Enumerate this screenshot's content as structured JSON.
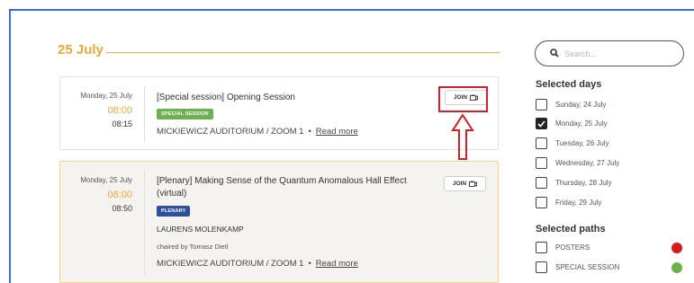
{
  "date_heading": "25 July",
  "sessions": [
    {
      "day": "Monday, 25 July",
      "start": "08:00",
      "end": "08:15",
      "title": "[Special session] Opening Session",
      "badge": "SPECIAL SESSION",
      "location": "MICKIEWICZ AUDITORIUM / ZOOM 1",
      "read_more": "Read more",
      "join_label": "JOIN"
    },
    {
      "day": "Monday, 25 July",
      "start": "08:00",
      "end": "08:50",
      "title": "[Plenary] Making Sense of the Quantum Anomalous Hall Effect (virtual)",
      "badge": "PLENARY",
      "speaker": "LAURENS MOLENKAMP",
      "chair": "chaired by Tomasz Dietl",
      "location": "MICKIEWICZ AUDITORIUM / ZOOM 1",
      "read_more": "Read more",
      "join_label": "JOIN"
    }
  ],
  "location_separator": "•",
  "search": {
    "placeholder": "Search..."
  },
  "selected_days": {
    "title": "Selected days",
    "items": [
      {
        "label": "Sunday, 24 July",
        "checked": false
      },
      {
        "label": "Monday, 25 July",
        "checked": true
      },
      {
        "label": "Tuesday, 26 July",
        "checked": false
      },
      {
        "label": "Wednesday, 27 July",
        "checked": false
      },
      {
        "label": "Thursday, 28 July",
        "checked": false
      },
      {
        "label": "Friday, 29 July",
        "checked": false
      }
    ]
  },
  "selected_paths": {
    "title": "Selected paths",
    "items": [
      {
        "label": "POSTERS",
        "checked": false,
        "color": "#d7191c"
      },
      {
        "label": "SPECIAL SESSION",
        "checked": false,
        "color": "#6db04e"
      }
    ]
  },
  "colors": {
    "accent": "#e8a93a",
    "annotation": "#d1202a",
    "frame": "#3a6fcf",
    "plenary_badge": "#2d4f9e",
    "special_badge": "#6db04e"
  },
  "icons": [
    "search-icon",
    "video-icon",
    "checkmark-icon",
    "up-arrow-icon"
  ]
}
